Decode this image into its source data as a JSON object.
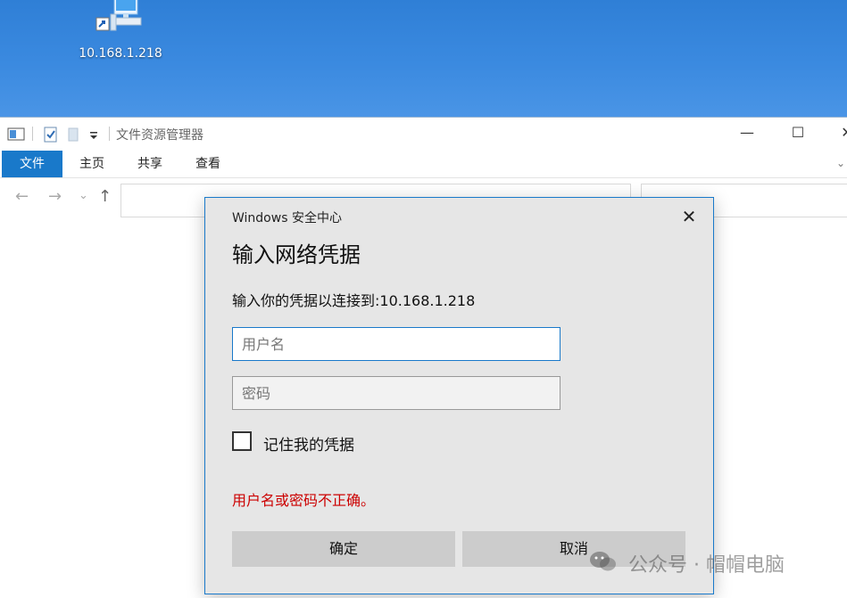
{
  "desktop": {
    "shortcut_label": "10.168.1.218"
  },
  "explorer": {
    "title": "文件资源管理器",
    "tabs": [
      "文件",
      "主页",
      "共享",
      "查看"
    ],
    "window_controls": {
      "minimize": "—",
      "maximize": "☐",
      "close": "✕"
    },
    "nav": {
      "back": "←",
      "forward": "→",
      "recent": "⌄",
      "up": "↑"
    },
    "ribbon_expand": "⌄"
  },
  "dialog": {
    "app_name": "Windows 安全中心",
    "close": "✕",
    "title": "输入网络凭据",
    "message": "输入你的凭据以连接到:10.168.1.218",
    "username": {
      "value": "",
      "placeholder": "用户名"
    },
    "password": {
      "value": "",
      "placeholder": "密码"
    },
    "remember_label": "记住我的凭据",
    "remember_checked": false,
    "error": "用户名或密码不正确。",
    "ok_label": "确定",
    "cancel_label": "取消",
    "colors": {
      "accent": "#1979ca",
      "error": "#cc0000",
      "button": "#cccccc"
    }
  },
  "watermark": {
    "text": "公众号 · 帽帽电脑"
  }
}
